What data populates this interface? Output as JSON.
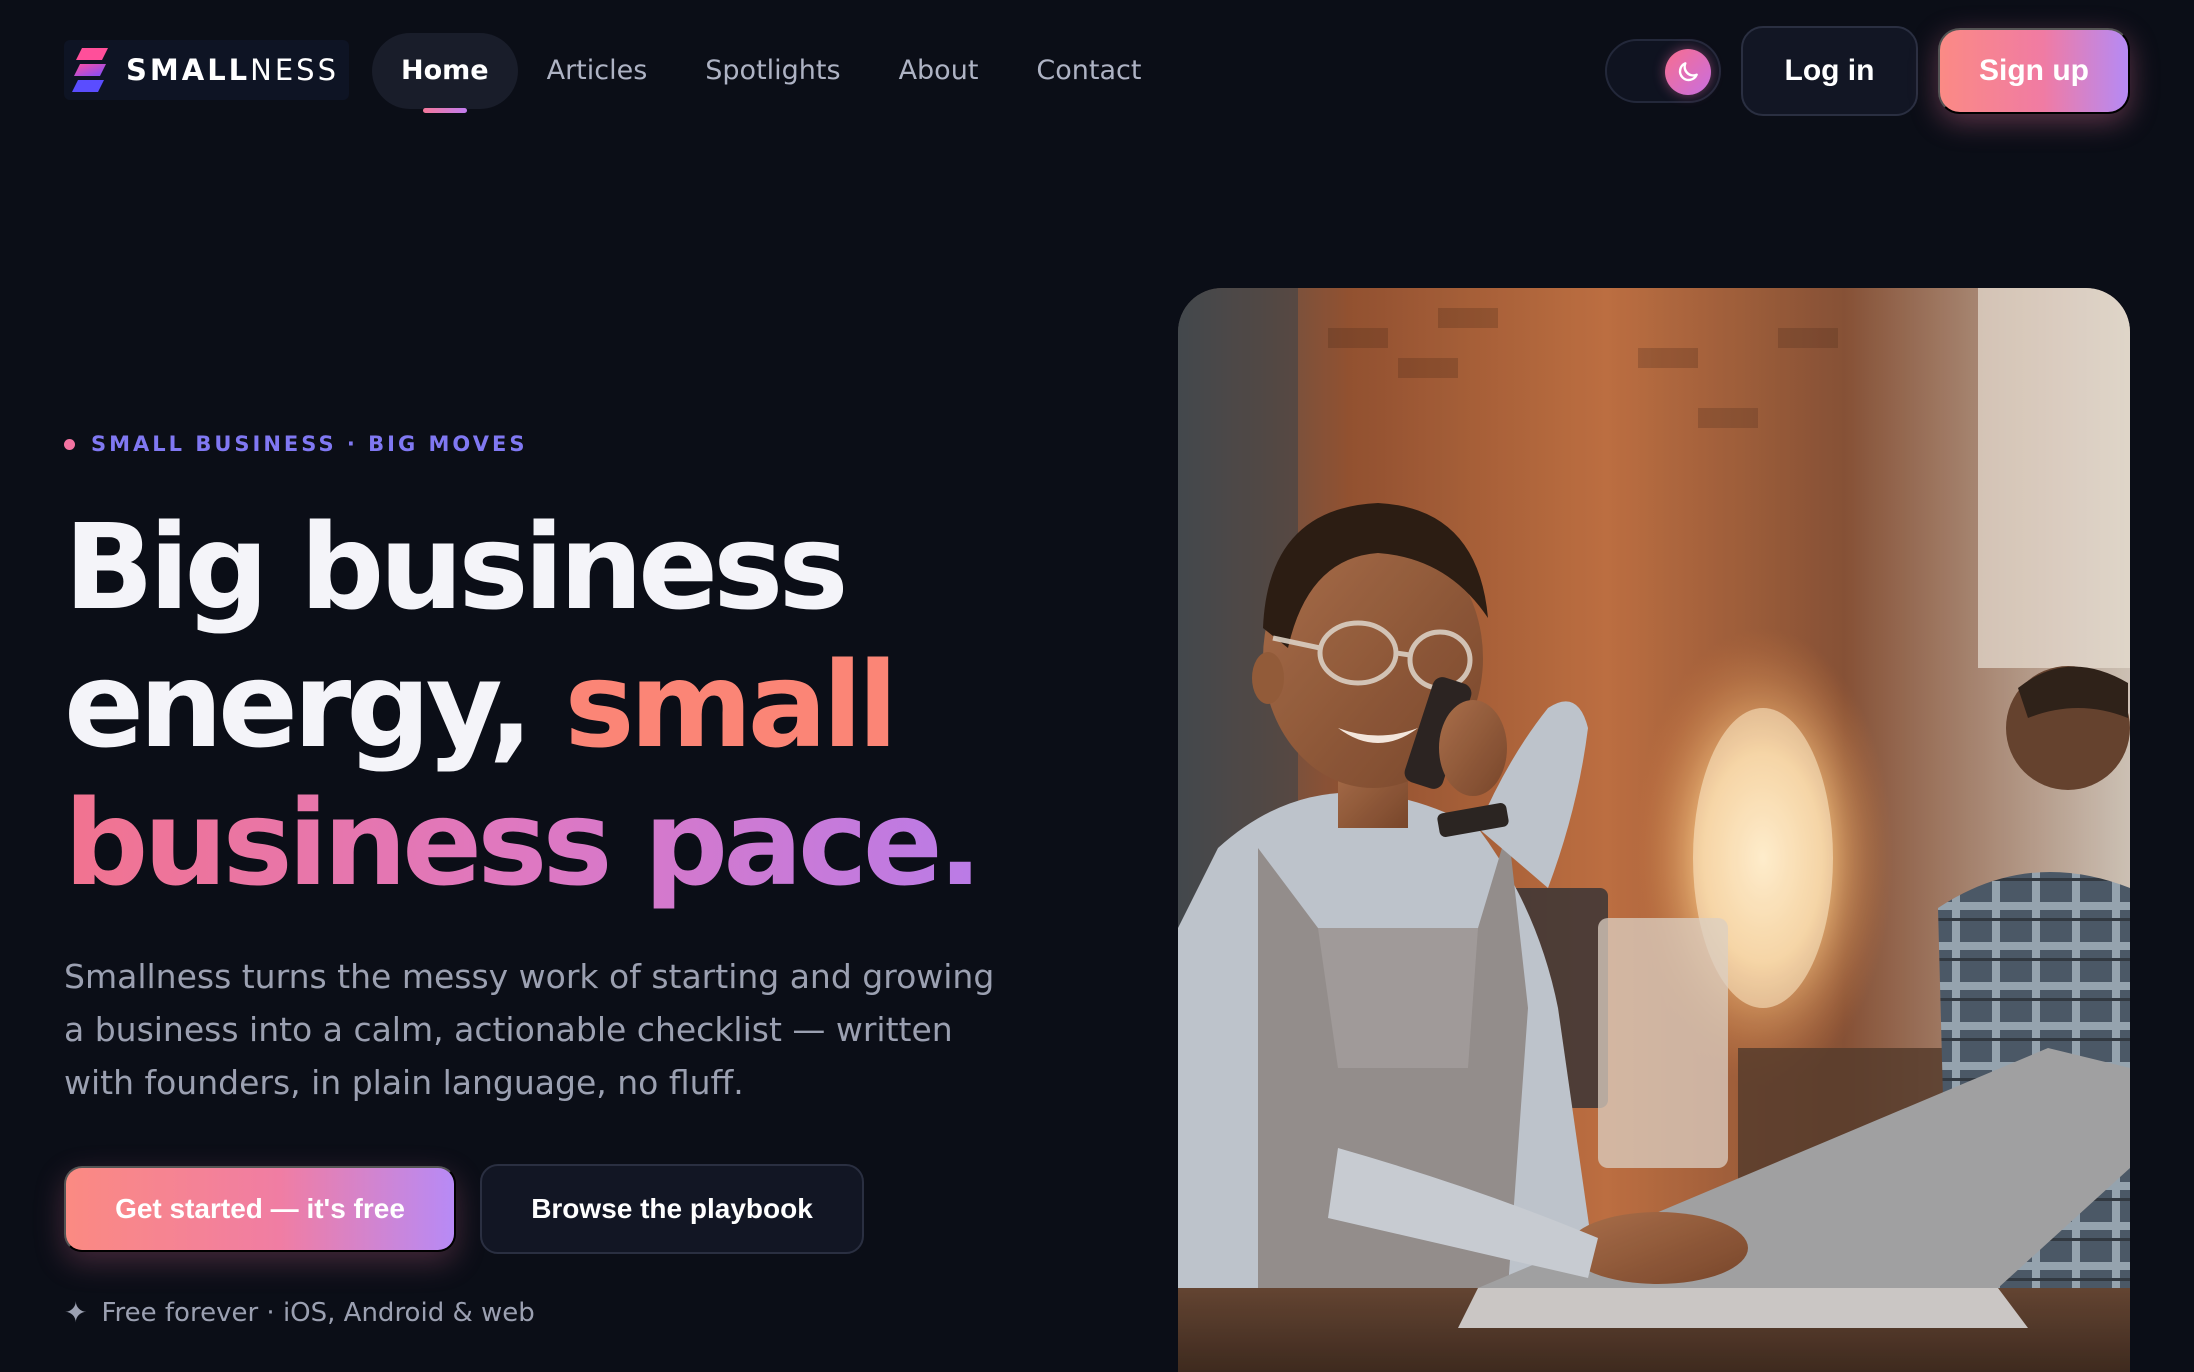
{
  "brand": {
    "name_bold": "SMALL",
    "name_thin": "NESS"
  },
  "nav": {
    "links": [
      {
        "label": "Home",
        "active": true
      },
      {
        "label": "Articles"
      },
      {
        "label": "Spotlights"
      },
      {
        "label": "About"
      },
      {
        "label": "Contact"
      }
    ],
    "theme_toggle_icon": "moon-icon",
    "login_label": "Log in",
    "signup_label": "Sign up"
  },
  "hero": {
    "eyebrow": "SMALL BUSINESS · BIG MOVES",
    "headline": {
      "line1": "Big business",
      "line2a": "energy, ",
      "line2b": "small",
      "line3": "business pace."
    },
    "subcopy": "Smallness turns the messy work of starting and growing a business into a calm, actionable checklist — written with founders, in plain language, no fluff.",
    "primary_cta": "Get started — it's free",
    "secondary_cta": "Browse the playbook",
    "footnote": "Free forever · iOS, Android & web"
  },
  "colors": {
    "background": "#0b0e17",
    "coral": "#fb8576",
    "pink": "#f2738f",
    "violet": "#b07cf1",
    "eyebrow": "#8078f2",
    "muted_text": "#9ba0b1"
  }
}
